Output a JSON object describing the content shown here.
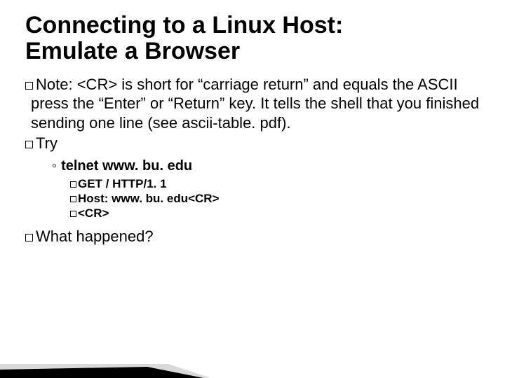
{
  "title_line1": "Connecting to a Linux Host:",
  "title_line2": "Emulate a Browser",
  "note_lead": "Note:",
  "note_rest": " <CR> is short for “carriage return” and equals the ASCII  press the “Enter” or “Return” key. It tells the shell that you finished sending one line (see ascii-table. pdf).",
  "try_label": "Try",
  "sub1": "telnet www. bu. edu",
  "cmd1": "GET / HTTP/1. 1",
  "cmd2": "Host: www. bu. edu<CR>",
  "cmd3": "<CR>",
  "what_lead": "What",
  "what_rest": " happened?"
}
